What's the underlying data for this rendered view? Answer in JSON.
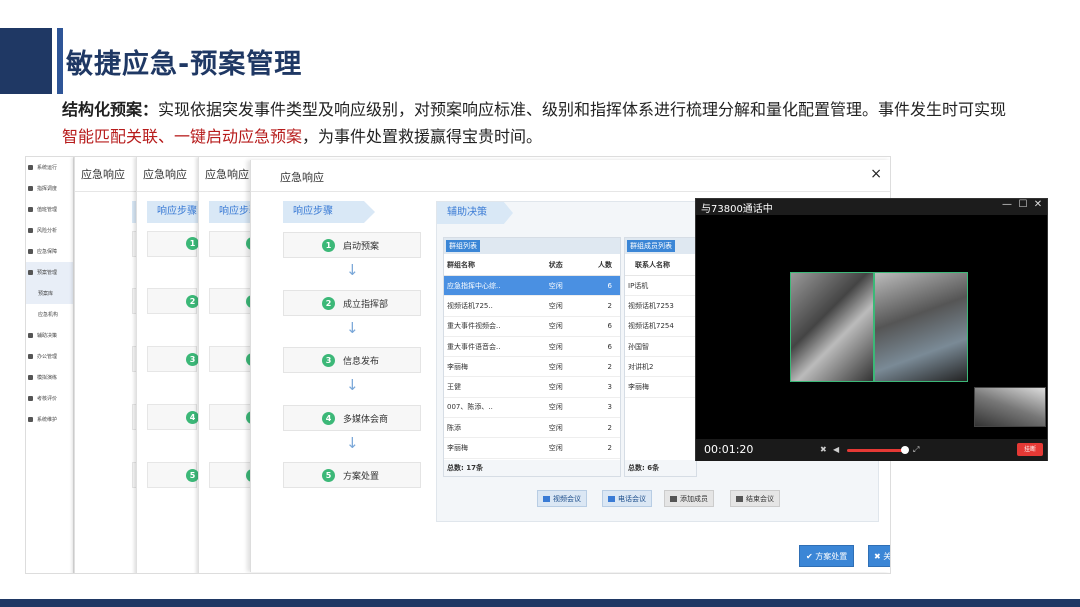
{
  "slide": {
    "title": "敏捷应急-预案管理",
    "desc_bold": "结构化预案：",
    "desc_text1": "实现依据突发事件类型及响应级别，对预案响应标准、级别和指挥体系进行梳理分解和量化配置管理。事件发生时可实现",
    "desc_highlight": "智能匹配关联、一键启动应急预案",
    "desc_text2": "，为事件处置救援赢得宝贵时间。",
    "accent_color": "#1f3864",
    "highlight_color": "#b71c1c"
  },
  "nav": {
    "items": [
      {
        "label": "系统运行",
        "icon": "home-icon"
      },
      {
        "label": "指挥调度",
        "icon": "flag-icon"
      },
      {
        "label": "值班管理",
        "icon": "calendar-icon"
      },
      {
        "label": "风险分析",
        "icon": "chart-icon"
      },
      {
        "label": "应急保障",
        "icon": "shield-icon"
      },
      {
        "label": "预案管理",
        "icon": "doc-icon"
      },
      {
        "label": "预案库",
        "icon": ""
      },
      {
        "label": "应急机构",
        "icon": ""
      },
      {
        "label": "辅助决策",
        "icon": "plus-icon"
      },
      {
        "label": "办公管理",
        "icon": "briefcase-icon"
      },
      {
        "label": "模拟演练",
        "icon": "film-icon"
      },
      {
        "label": "考核评价",
        "icon": "pin-icon"
      },
      {
        "label": "系统维护",
        "icon": "gear-icon"
      }
    ]
  },
  "panels": {
    "title": "应急响应",
    "step_tab": "响应步骤"
  },
  "modal": {
    "title": "应急响应",
    "close": "×",
    "step_tab": "响应步骤",
    "assist_tab": "辅助决策",
    "steps": [
      {
        "num": "1",
        "label": "启动预案"
      },
      {
        "num": "2",
        "label": "成立指挥部"
      },
      {
        "num": "3",
        "label": "信息发布"
      },
      {
        "num": "4",
        "label": "多媒体会商"
      },
      {
        "num": "5",
        "label": "方案处置"
      }
    ],
    "arrow": "↓",
    "groups": {
      "tag": "群组列表",
      "headers": [
        "群组名称",
        "状态",
        "人数"
      ],
      "rows": [
        [
          "应急指挥中心综..",
          "空闲",
          "6"
        ],
        [
          "视频话机725..",
          "空闲",
          "2"
        ],
        [
          "重大事件视频会..",
          "空闲",
          "6"
        ],
        [
          "重大事件语音会..",
          "空闲",
          "6"
        ],
        [
          "李丽梅",
          "空闲",
          "2"
        ],
        [
          "王健",
          "空闲",
          "3"
        ],
        [
          "007、陈添、..",
          "空闲",
          "3"
        ],
        [
          "陈添",
          "空闲",
          "2"
        ],
        [
          "李丽梅",
          "空闲",
          "2"
        ]
      ],
      "total": "总数: 17条"
    },
    "members": {
      "tag": "群组成员列表",
      "header": "联系人名称",
      "rows": [
        "IP话机",
        "视频话机7253",
        "视频话机7254",
        "孙国智",
        "对讲机2",
        "李丽梅"
      ],
      "total": "总数: 6条"
    },
    "actions": [
      {
        "label": "视频会议",
        "icon": "video-icon"
      },
      {
        "label": "电话会议",
        "icon": "phone-icon"
      },
      {
        "label": "添加成员",
        "icon": "add-user-icon"
      },
      {
        "label": "结束会议",
        "icon": "close-icon"
      }
    ],
    "btn_plan": "✔ 方案处置",
    "btn_close": "✖ 关闭"
  },
  "video": {
    "title": "与73800通话中",
    "min": "—",
    "max": "☐",
    "close": "✕",
    "time": "00:01:20",
    "mute": "✖",
    "speaker": "◀",
    "fullscreen": "⤢",
    "hangup": "挂断",
    "volume": 0.9
  }
}
